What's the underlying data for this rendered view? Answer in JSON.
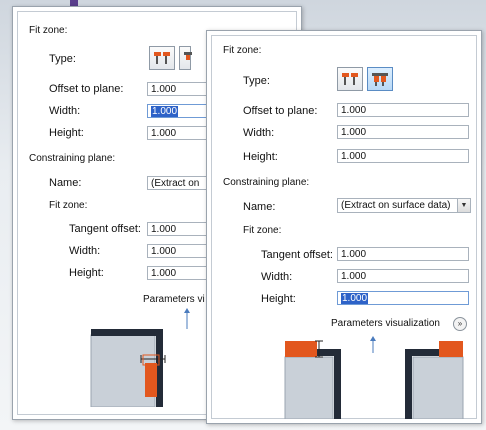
{
  "back_panel": {
    "fit_zone_header": "Fit zone:",
    "type_label": "Type:",
    "offset_label": "Offset to plane:",
    "offset_value": "1.000",
    "width_label": "Width:",
    "width_value": "1.000",
    "height_label": "Height:",
    "height_value": "1.000",
    "constraining_header": "Constraining plane:",
    "name_label": "Name:",
    "name_value": "(Extract on s",
    "fit_zone2_header": "Fit zone:",
    "tangent_label": "Tangent offset:",
    "tangent_value": "1.000",
    "width2_label": "Width:",
    "width2_value": "1.000",
    "height2_label": "Height:",
    "height2_value": "1.000",
    "params_viz_label": "Parameters vi"
  },
  "front_panel": {
    "fit_zone_header": "Fit zone:",
    "type_label": "Type:",
    "offset_label": "Offset to plane:",
    "offset_value": "1.000",
    "width_label": "Width:",
    "width_value": "1.000",
    "height_label": "Height:",
    "height_value": "1.000",
    "constraining_header": "Constraining plane:",
    "name_label": "Name:",
    "name_value": "(Extract on surface data)",
    "fit_zone2_header": "Fit zone:",
    "tangent_label": "Tangent offset:",
    "tangent_value": "1.000",
    "width2_label": "Width:",
    "width2_value": "1.000",
    "height2_label": "Height:",
    "height2_value": "1.000",
    "params_viz_label": "Parameters visualization",
    "expander_glyph": "»"
  },
  "colors": {
    "selection": "#2d62c8",
    "fit_zone_orange": "#e2571e",
    "plane_dark": "#232b38",
    "part_fill": "#c9d0d8"
  },
  "icons": [
    "type-fit-outer-icon",
    "type-fit-inner-icon",
    "dropdown-arrow-icon",
    "expand-chevron-icon"
  ]
}
